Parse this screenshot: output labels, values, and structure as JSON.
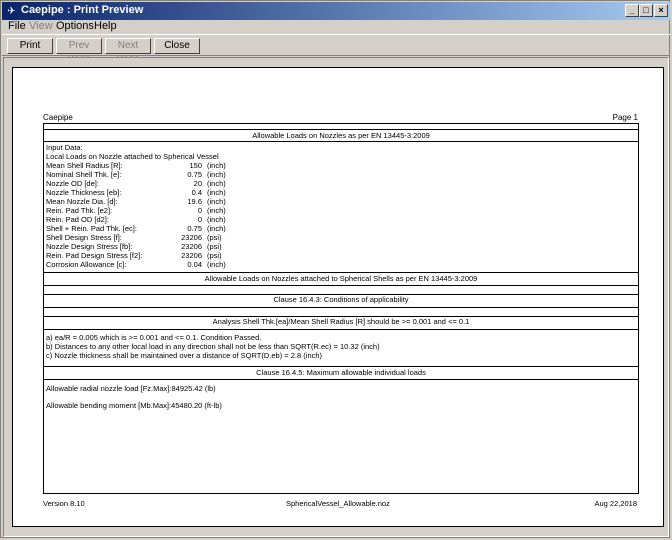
{
  "window": {
    "title": "Caepipe : Print Preview",
    "minimize_glyph": "_",
    "maximize_glyph": "□",
    "close_glyph": "×"
  },
  "menu": {
    "items": [
      "File",
      "View",
      "Options",
      "Help"
    ]
  },
  "toolbar": {
    "print": "Print",
    "prev_page": "Prev Page",
    "next_page": "Next Page",
    "close": "Close"
  },
  "page": {
    "header_left": "Caepipe",
    "header_right": "Page 1",
    "section_title": "Allowable Loads on Nozzles as per EN 13445-3:2009",
    "input_title": "Input Data:",
    "input_subtitle": "Local Loads on Nozzle attached to Spherical Vessel",
    "inputs": [
      {
        "label": "Mean Shell Radius [R]:",
        "value": "150",
        "unit": "(inch)"
      },
      {
        "label": "Nominal Shell Thk. [e]:",
        "value": "0.75",
        "unit": "(inch)"
      },
      {
        "label": "Nozzle OD [de]:",
        "value": "20",
        "unit": "(inch)"
      },
      {
        "label": "Nozzle Thickness [eb]:",
        "value": "0.4",
        "unit": "(inch)"
      },
      {
        "label": "Mean Nozzle Dia. [d]:",
        "value": "19.6",
        "unit": "(inch)"
      },
      {
        "label": "Rein. Pad Thk. [e2]:",
        "value": "0",
        "unit": "(inch)"
      },
      {
        "label": "Rein. Pad OD [d2]:",
        "value": "0",
        "unit": "(inch)"
      },
      {
        "label": "Shell + Rein. Pad Thk. [ec]:",
        "value": "0.75",
        "unit": "(inch)"
      },
      {
        "label": "Shell Design Stress [f]:",
        "value": "23206",
        "unit": "(psi)"
      },
      {
        "label": "Nozzle Design Stress [fb]:",
        "value": "23206",
        "unit": "(psi)"
      },
      {
        "label": "Rein. Pad Design Stress [f2]:",
        "value": "23206",
        "unit": "(psi)"
      },
      {
        "label": "Corrosion Allowance [c]:",
        "value": "0.04",
        "unit": "(inch)"
      }
    ],
    "section2_title": "Allowable Loads on Nozzles attached to Spherical Shells as per EN 13445-3:2009",
    "clause_1643": "Clause 16.4.3: Conditions of applicability",
    "analysis_title": "Analysis Shell Thk.[ea]/Mean Shell Radius [R] should be >= 0.001 and <= 0.1",
    "conditions": [
      "a) ea/R = 0.005 which is >= 0.001 and <= 0.1. Condition Passed.",
      "b) Distances to any other local load in any direction shall not be less than SQRT(R.ec) = 10.32 (inch)",
      "c) Nozzle thickness shall be maintained over a distance of SQRT(D.eb) = 2.8 (inch)"
    ],
    "clause_1645": "Clause 16.4.5: Maximum allowable individual loads",
    "results": [
      "Allowable radial nozzle load [Fz.Max]:84925.42  (lb)",
      "Allowable bending moment [Mb.Max]:45480.20  (ft-lb)"
    ],
    "footer_left": "Version 8.10",
    "footer_center": "SphericalVessel_Allowable.noz",
    "footer_right": "Aug 22,2018"
  }
}
